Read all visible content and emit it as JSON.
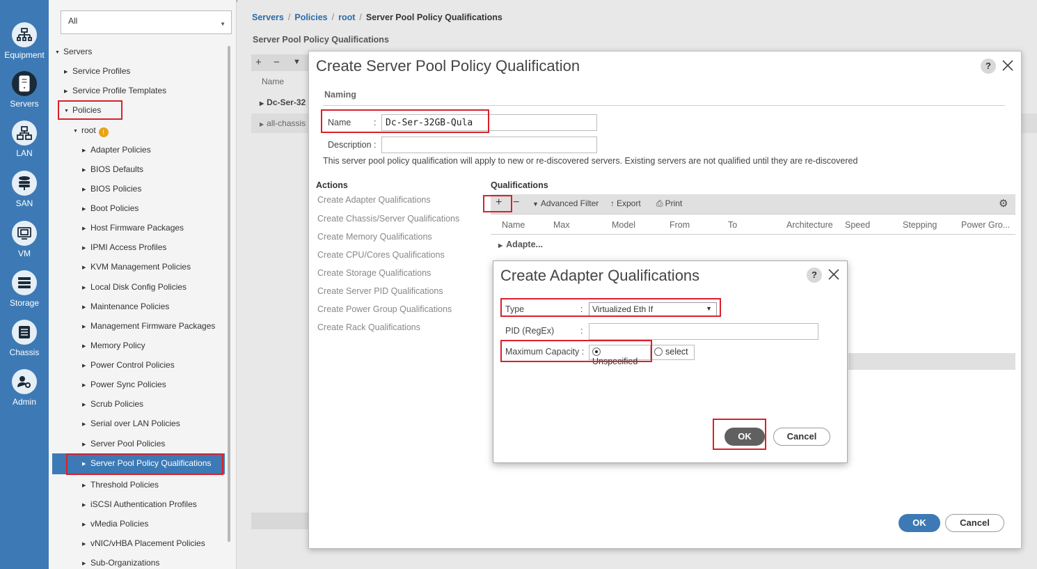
{
  "rail": {
    "items": [
      {
        "label": "Equipment",
        "icon": "equipment-icon"
      },
      {
        "label": "Servers",
        "icon": "server-icon"
      },
      {
        "label": "LAN",
        "icon": "lan-icon"
      },
      {
        "label": "SAN",
        "icon": "san-icon"
      },
      {
        "label": "VM",
        "icon": "vm-icon"
      },
      {
        "label": "Storage",
        "icon": "storage-icon"
      },
      {
        "label": "Chassis",
        "icon": "chassis-icon"
      },
      {
        "label": "Admin",
        "icon": "admin-icon"
      }
    ],
    "active": "Servers",
    "color": "#3d7ab5"
  },
  "nav": {
    "filter_value": "All",
    "tree": [
      "Servers",
      "Service Profiles",
      "Service Profile Templates",
      "Policies",
      "root",
      "Adapter Policies",
      "BIOS Defaults",
      "BIOS Policies",
      "Boot Policies",
      "Host Firmware Packages",
      "IPMI Access Profiles",
      "KVM Management Policies",
      "Local Disk Config Policies",
      "Maintenance Policies",
      "Management Firmware Packages",
      "Memory Policy",
      "Power Control Policies",
      "Power Sync Policies",
      "Scrub Policies",
      "Serial over LAN Policies",
      "Server Pool Policies",
      "Server Pool Policy Qualifications",
      "Threshold Policies",
      "iSCSI Authentication Profiles",
      "vMedia Policies",
      "vNIC/vHBA Placement Policies",
      "Sub-Organizations"
    ],
    "root_badge": "!"
  },
  "breadcrumb": {
    "items": [
      "Servers",
      "Policies",
      "root"
    ],
    "current": "Server Pool Policy Qualifications",
    "sep": "/"
  },
  "background": {
    "title": "Server Pool Policy Qualifications",
    "name_col": "Name",
    "row1": "Dc-Ser-32",
    "row2": "all-chassis"
  },
  "dialog1": {
    "title": "Create Server Pool Policy Qualification",
    "help": "?",
    "naming_label": "Naming",
    "name_label": "Name",
    "name_colon": ":",
    "name_value": "Dc-Ser-32GB-Qula",
    "description_label": "Description :",
    "description_value": "",
    "info": "This server pool policy qualification will apply to new or re-discovered servers. Existing servers are not qualified until they are re-discovered",
    "actions_header": "Actions",
    "actions": [
      "Create Adapter Qualifications",
      "Create Chassis/Server Qualifications",
      "Create Memory Qualifications",
      "Create CPU/Cores Qualifications",
      "Create Storage Qualifications",
      "Create Server PID Qualifications",
      "Create Power Group Qualifications",
      "Create Rack Qualifications"
    ],
    "quals_header": "Qualifications",
    "toolbar": {
      "add": "+",
      "remove": "−",
      "advanced_filter": "Advanced Filter",
      "export": "Export",
      "print": "Print"
    },
    "columns": [
      "Name",
      "Max",
      "Model",
      "From",
      "To",
      "Architecture",
      "Speed",
      "Stepping",
      "Power Gro..."
    ],
    "adapter_row": "Adapte...",
    "ok": "OK",
    "cancel": "Cancel"
  },
  "dialog2": {
    "title": "Create Adapter Qualifications",
    "help": "?",
    "type_label": "Type",
    "type_colon": ":",
    "type_value": "Virtualized Eth If",
    "pid_label": "PID (RegEx)",
    "pid_colon": ":",
    "pid_value": "",
    "max_cap_label": "Maximum Capacity :",
    "options": [
      "Unspecified",
      "select"
    ],
    "selected_option": "Unspecified",
    "ok": "OK",
    "cancel": "Cancel"
  },
  "colors": {
    "highlight": "#d9202b",
    "accent": "#3d7ab5",
    "link": "#2c6ba7"
  }
}
